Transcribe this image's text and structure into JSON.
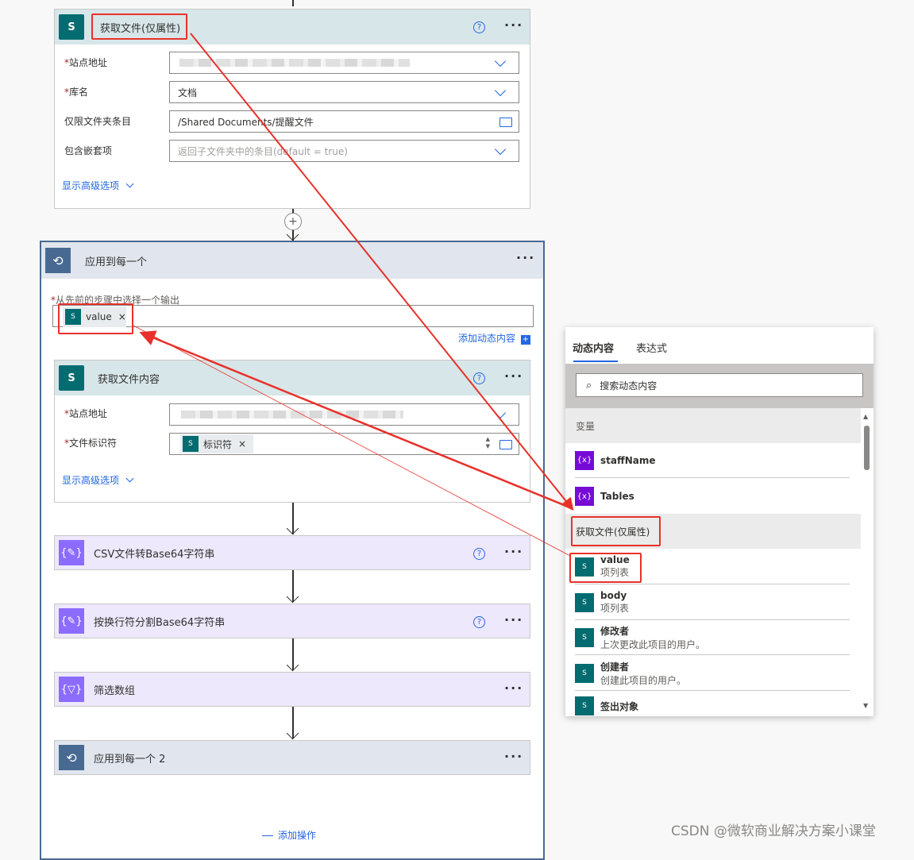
{
  "step1": {
    "title": "获取文件(仅属性)",
    "fields": [
      {
        "label": "站点地址",
        "required": true,
        "value": ""
      },
      {
        "label": "库名",
        "required": true,
        "value": "文档"
      },
      {
        "label": "仅限文件夹条目",
        "required": false,
        "value": "/Shared Documents/提醒文件"
      },
      {
        "label": "包含嵌套项",
        "required": false,
        "placeholder": "返回子文件夹中的条目(default = true)"
      }
    ],
    "advanced": "显示高级选项"
  },
  "loop": {
    "title": "应用到每一个",
    "select_label": "从先前的步骤中选择一个输出",
    "token": "value",
    "add_dynamic": "添加动态内容",
    "inner": {
      "title": "获取文件内容",
      "fields": [
        {
          "label": "站点地址",
          "required": true,
          "value": ""
        },
        {
          "label": "文件标识符",
          "required": true,
          "token": "标识符"
        }
      ],
      "advanced": "显示高级选项"
    },
    "actions": [
      {
        "title": "CSV文件转Base64字符串",
        "icon": "variable-icon",
        "help": true
      },
      {
        "title": "按换行符分割Base64字符串",
        "icon": "variable-icon",
        "help": true
      },
      {
        "title": "筛选数组",
        "icon": "filter-icon",
        "help": false
      },
      {
        "title": "应用到每一个 2",
        "icon": "loop-icon",
        "help": false
      }
    ],
    "add_action": "添加操作"
  },
  "panel": {
    "tabs": [
      "动态内容",
      "表达式"
    ],
    "search_placeholder": "搜索动态内容",
    "section_vars": "变量",
    "vars": [
      "staffName",
      "Tables"
    ],
    "section_getfiles": "获取文件(仅属性)",
    "items": [
      {
        "name": "value",
        "desc": "项列表"
      },
      {
        "name": "body",
        "desc": "项列表"
      },
      {
        "name": "修改者",
        "desc": "上次更改此项目的用户。"
      },
      {
        "name": "创建者",
        "desc": "创建此项目的用户。"
      },
      {
        "name": "签出对象",
        "desc": ""
      }
    ]
  },
  "watermark": "CSDN @微软商业解决方案小课堂",
  "colors": {
    "accent": "#2266e3",
    "sharepoint": "#036c70",
    "variable": "#8c6cff",
    "loop": "#486991",
    "annotation": "#e8312a"
  }
}
